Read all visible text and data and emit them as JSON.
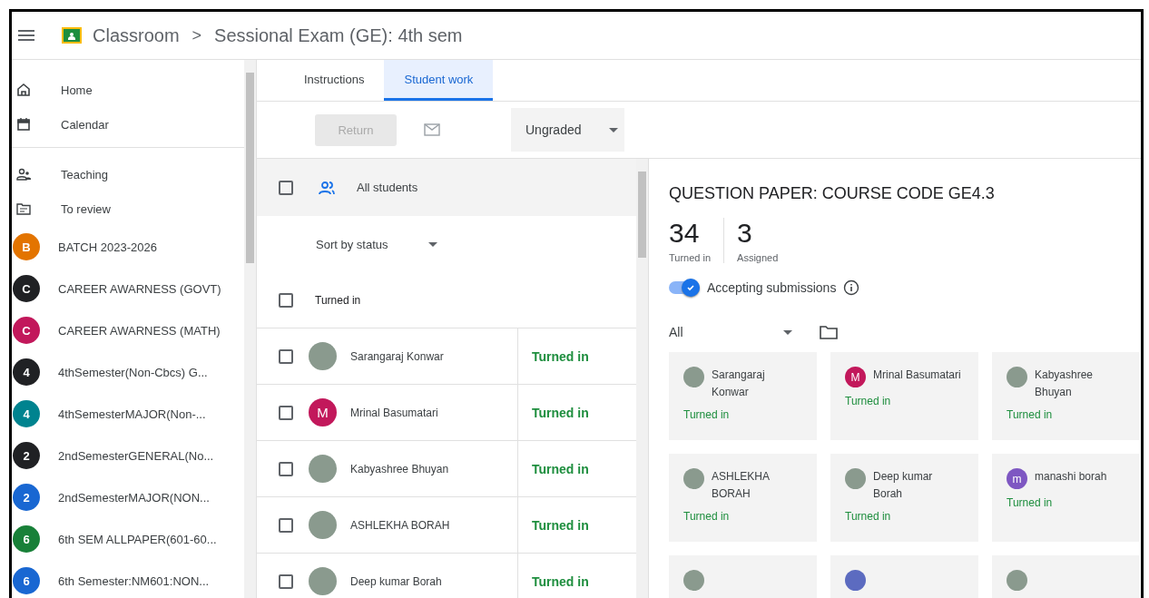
{
  "header": {
    "app": "Classroom",
    "separator": ">",
    "title": "Sessional Exam (GE): 4th sem"
  },
  "sidebar": {
    "nav": [
      {
        "kind": "home",
        "label": "Home"
      },
      {
        "kind": "calendar",
        "label": "Calendar"
      }
    ],
    "sections": [
      {
        "kind": "teaching",
        "label": "Teaching"
      },
      {
        "kind": "review",
        "label": "To review"
      }
    ],
    "classes": [
      {
        "letter": "B",
        "label": "BATCH 2023-2026",
        "color": "#e37400"
      },
      {
        "letter": "C",
        "label": "CAREER AWARNESS (GOVT)",
        "color": "#202124"
      },
      {
        "letter": "C",
        "label": "CAREER AWARNESS (MATH)",
        "color": "#c2185b"
      },
      {
        "letter": "4",
        "label": "4thSemester(Non-Cbcs) G...",
        "color": "#202124"
      },
      {
        "letter": "4",
        "label": "4thSemesterMAJOR(Non-...",
        "color": "#00838f"
      },
      {
        "letter": "2",
        "label": "2ndSemesterGENERAL(No...",
        "color": "#202124"
      },
      {
        "letter": "2",
        "label": "2ndSemesterMAJOR(NON...",
        "color": "#1967d2"
      },
      {
        "letter": "6",
        "label": "6th SEM ALLPAPER(601-60...",
        "color": "#188038"
      },
      {
        "letter": "6",
        "label": "6th Semester:NM601:NON...",
        "color": "#1967d2"
      }
    ]
  },
  "tabs": [
    {
      "label": "Instructions",
      "selected": false
    },
    {
      "label": "Student work",
      "selected": true
    }
  ],
  "toolbar": {
    "return_button": {
      "label": "Return",
      "disabled": true
    },
    "grade_filter": "Ungraded"
  },
  "student_list": {
    "all_label": "All students",
    "all_checked": false,
    "sort": "Sort by status",
    "group": {
      "label": "Turned in",
      "checked": false
    },
    "rows": [
      {
        "name": "Sarangaraj Konwar",
        "kind": "photo",
        "status": "Turned in",
        "checked": false
      },
      {
        "name": "Mrinal Basumatari",
        "kind": "letter",
        "letter": "M",
        "color": "#c2185b",
        "status": "Turned in",
        "checked": false
      },
      {
        "name": "Kabyashree Bhuyan",
        "kind": "photo",
        "status": "Turned in",
        "checked": false
      },
      {
        "name": "ASHLEKHA BORAH",
        "kind": "photo",
        "status": "Turned in",
        "checked": false
      },
      {
        "name": "Deep kumar Borah",
        "kind": "photo",
        "status": "Turned in",
        "checked": false
      }
    ]
  },
  "detail": {
    "title": "QUESTION PAPER: COURSE CODE GE4.3",
    "stats": [
      {
        "value": "34",
        "label": "Turned in"
      },
      {
        "value": "3",
        "label": "Assigned"
      }
    ],
    "accepting": {
      "label": "Accepting submissions",
      "on": true
    },
    "filter": "All",
    "cards": [
      {
        "name": "Sarangaraj Konwar",
        "kind": "photo",
        "status": "Turned in"
      },
      {
        "name": "Mrinal Basumatari",
        "kind": "letter",
        "letter": "M",
        "color": "#c2185b",
        "status": "Turned in"
      },
      {
        "name": "Kabyashree Bhuyan",
        "kind": "photo",
        "status": "Turned in"
      },
      {
        "name": "ASHLEKHA BORAH",
        "kind": "photo",
        "status": "Turned in"
      },
      {
        "name": "Deep kumar Borah",
        "kind": "photo",
        "status": "Turned in"
      },
      {
        "name": "manashi borah",
        "kind": "letter",
        "letter": "m",
        "color": "#7e57c2",
        "status": "Turned in"
      },
      {
        "kind": "photo"
      },
      {
        "kind": "letter",
        "color": "#5c6bc0"
      },
      {
        "kind": "photo"
      }
    ]
  }
}
